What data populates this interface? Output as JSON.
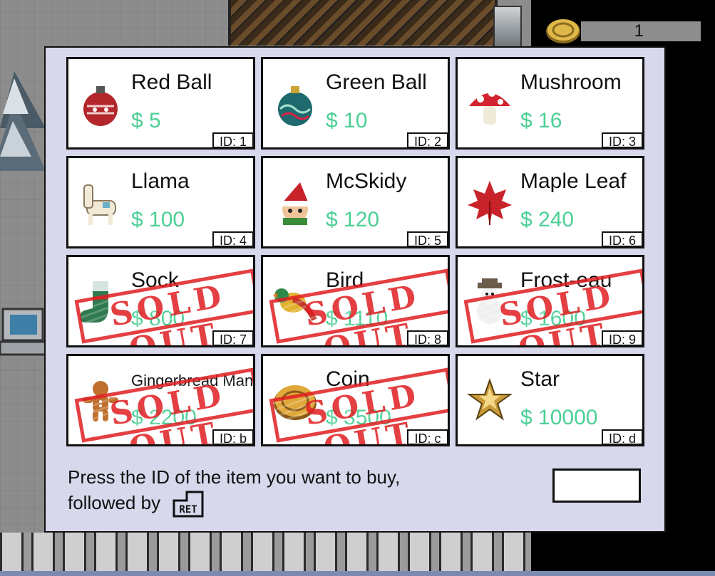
{
  "coins": "1",
  "shop": {
    "items": [
      {
        "name": "Red Ball",
        "price": "$ 5",
        "id": "ID: 1",
        "icon": "red-ornament",
        "sold_out": false
      },
      {
        "name": "Green Ball",
        "price": "$ 10",
        "id": "ID: 2",
        "icon": "green-ornament",
        "sold_out": false
      },
      {
        "name": "Mushroom",
        "price": "$ 16",
        "id": "ID: 3",
        "icon": "mushroom",
        "sold_out": false
      },
      {
        "name": "Llama",
        "price": "$ 100",
        "id": "ID: 4",
        "icon": "llama",
        "sold_out": false
      },
      {
        "name": "McSkidy",
        "price": "$ 120",
        "id": "ID: 5",
        "icon": "elf-mcskidy",
        "sold_out": false
      },
      {
        "name": "Maple Leaf",
        "price": "$ 240",
        "id": "ID: 6",
        "icon": "maple-leaf",
        "sold_out": false
      },
      {
        "name": "Sock",
        "price": "$ 800",
        "id": "ID: 7",
        "icon": "sock",
        "sold_out": true
      },
      {
        "name": "Bird",
        "price": "$ 1110",
        "id": "ID: 8",
        "icon": "bird",
        "sold_out": true
      },
      {
        "name": "Frost-eau",
        "price": "$ 1600",
        "id": "ID: 9",
        "icon": "snowman-frost-eau",
        "sold_out": true
      },
      {
        "name": "Gingerbread Man",
        "price": "$ 2200",
        "id": "ID: b",
        "icon": "gingerbread-man",
        "sold_out": true
      },
      {
        "name": "Coin",
        "price": "$ 3500",
        "id": "ID: c",
        "icon": "coin",
        "sold_out": true
      },
      {
        "name": "Star",
        "price": "$ 10000",
        "id": "ID: d",
        "icon": "star",
        "sold_out": false
      }
    ],
    "sold_out_label": "SOLD OUT",
    "prompt_line1": "Press the ID of the item you want to buy,",
    "prompt_line2": "followed by",
    "ret_key_label": "RET",
    "input_value": ""
  },
  "colors": {
    "panel_bg": "#d8d8ec",
    "price_green": "#4ccf95",
    "stamp_red": "#e01e22"
  }
}
